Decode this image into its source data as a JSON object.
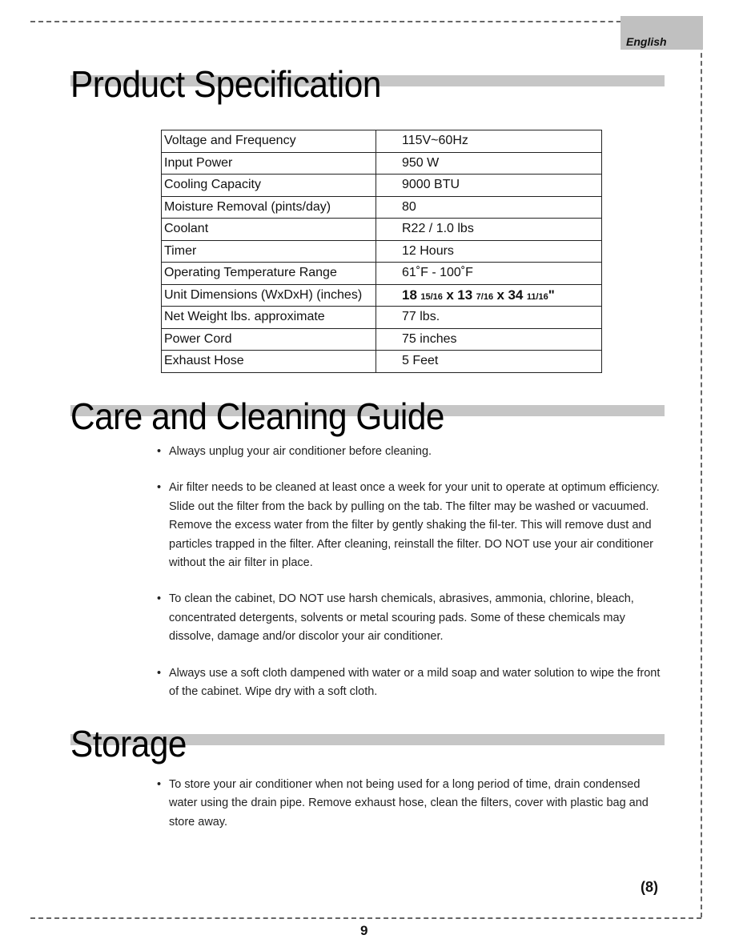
{
  "header": {
    "language_tab": "English"
  },
  "sections": {
    "spec": {
      "title": "Product Specification",
      "rows": [
        {
          "label": "Voltage and Frequency",
          "value": "115V~60Hz"
        },
        {
          "label": "Input Power",
          "value": "950 W"
        },
        {
          "label": "Cooling Capacity",
          "value": "9000 BTU"
        },
        {
          "label": "Moisture Removal (pints/day)",
          "value": "80"
        },
        {
          "label": "Coolant",
          "value": "R22 / 1.0 lbs"
        },
        {
          "label": "Timer",
          "value": "12 Hours"
        },
        {
          "label": "Operating Temperature Range",
          "value": "61˚F - 100˚F"
        },
        {
          "label": "Unit Dimensions (WxDxH) (inches)",
          "value": "18 15/16 x 13 7/16 x 34 11/16\"",
          "parts": {
            "w": "18",
            "w_frac": "15/16",
            "d": "13",
            "d_frac": "7/16",
            "h": "34",
            "h_frac": "11/16",
            "x": "x",
            "unit": "\""
          }
        },
        {
          "label": "Net Weight lbs. approximate",
          "value": "77 lbs."
        },
        {
          "label": "Power Cord",
          "value": "75 inches"
        },
        {
          "label": "Exhaust Hose",
          "value": "5 Feet"
        }
      ]
    },
    "care": {
      "title": "Care and Cleaning Guide",
      "items": [
        "Always unplug your air conditioner before cleaning.",
        "Air filter needs to be cleaned at least once a week for your unit to operate at optimum efficiency. Slide out the filter from the back by pulling on the tab. The filter may be washed or vacuumed. Remove the excess water from the filter by gently shaking the fil-ter. This will remove dust and particles trapped in the filter. After cleaning, reinstall the filter. DO NOT use your air conditioner without the air filter in place.",
        "To clean the cabinet, DO NOT use harsh chemicals, abrasives, ammonia, chlorine, bleach, concentrated detergents, solvents or metal scouring pads. Some of these chemicals may dissolve, damage and/or discolor your air conditioner.",
        "Always use a soft cloth dampened with water or a mild soap and water solution to wipe the front of the cabinet. Wipe dry with a soft cloth."
      ]
    },
    "storage": {
      "title": "Storage",
      "items": [
        "To store your air conditioner when not being used for a long period of time, drain condensed water using the drain pipe. Remove exhaust hose, clean the filters, cover with plastic bag and store away."
      ]
    }
  },
  "footer": {
    "section_page": "(8)",
    "page_number": "9"
  }
}
